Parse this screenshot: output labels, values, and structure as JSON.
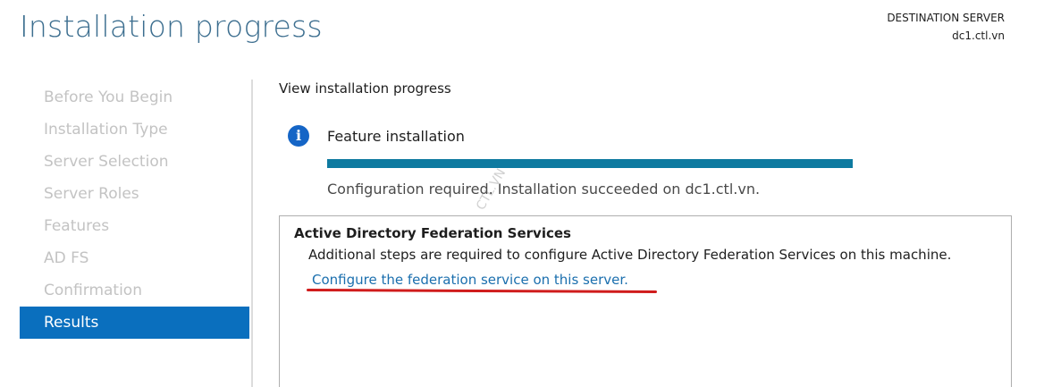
{
  "header": {
    "title": "Installation progress",
    "destination_label": "DESTINATION SERVER",
    "destination_value": "dc1.ctl.vn"
  },
  "sidebar": {
    "items": [
      {
        "label": "Before You Begin",
        "active": false
      },
      {
        "label": "Installation Type",
        "active": false
      },
      {
        "label": "Server Selection",
        "active": false
      },
      {
        "label": "Server Roles",
        "active": false
      },
      {
        "label": "Features",
        "active": false
      },
      {
        "label": "AD FS",
        "active": false
      },
      {
        "label": "Confirmation",
        "active": false
      },
      {
        "label": "Results",
        "active": true
      }
    ]
  },
  "main": {
    "heading": "View installation progress",
    "feature": {
      "icon": "info-icon",
      "label": "Feature installation",
      "progress_percent": 100,
      "status": "Configuration required. Installation succeeded on dc1.ctl.vn."
    },
    "results": {
      "title": "Active Directory Federation Services",
      "description": "Additional steps are required to configure Active Directory Federation Services on this machine.",
      "link": "Configure the federation service on this server."
    }
  },
  "watermark": "CTL.VN",
  "colors": {
    "title": "#3c6e8f",
    "active_nav": "#0a6fbe",
    "progress": "#0e7aa0",
    "link": "#1b6fae",
    "annotation": "#d01c1c"
  }
}
